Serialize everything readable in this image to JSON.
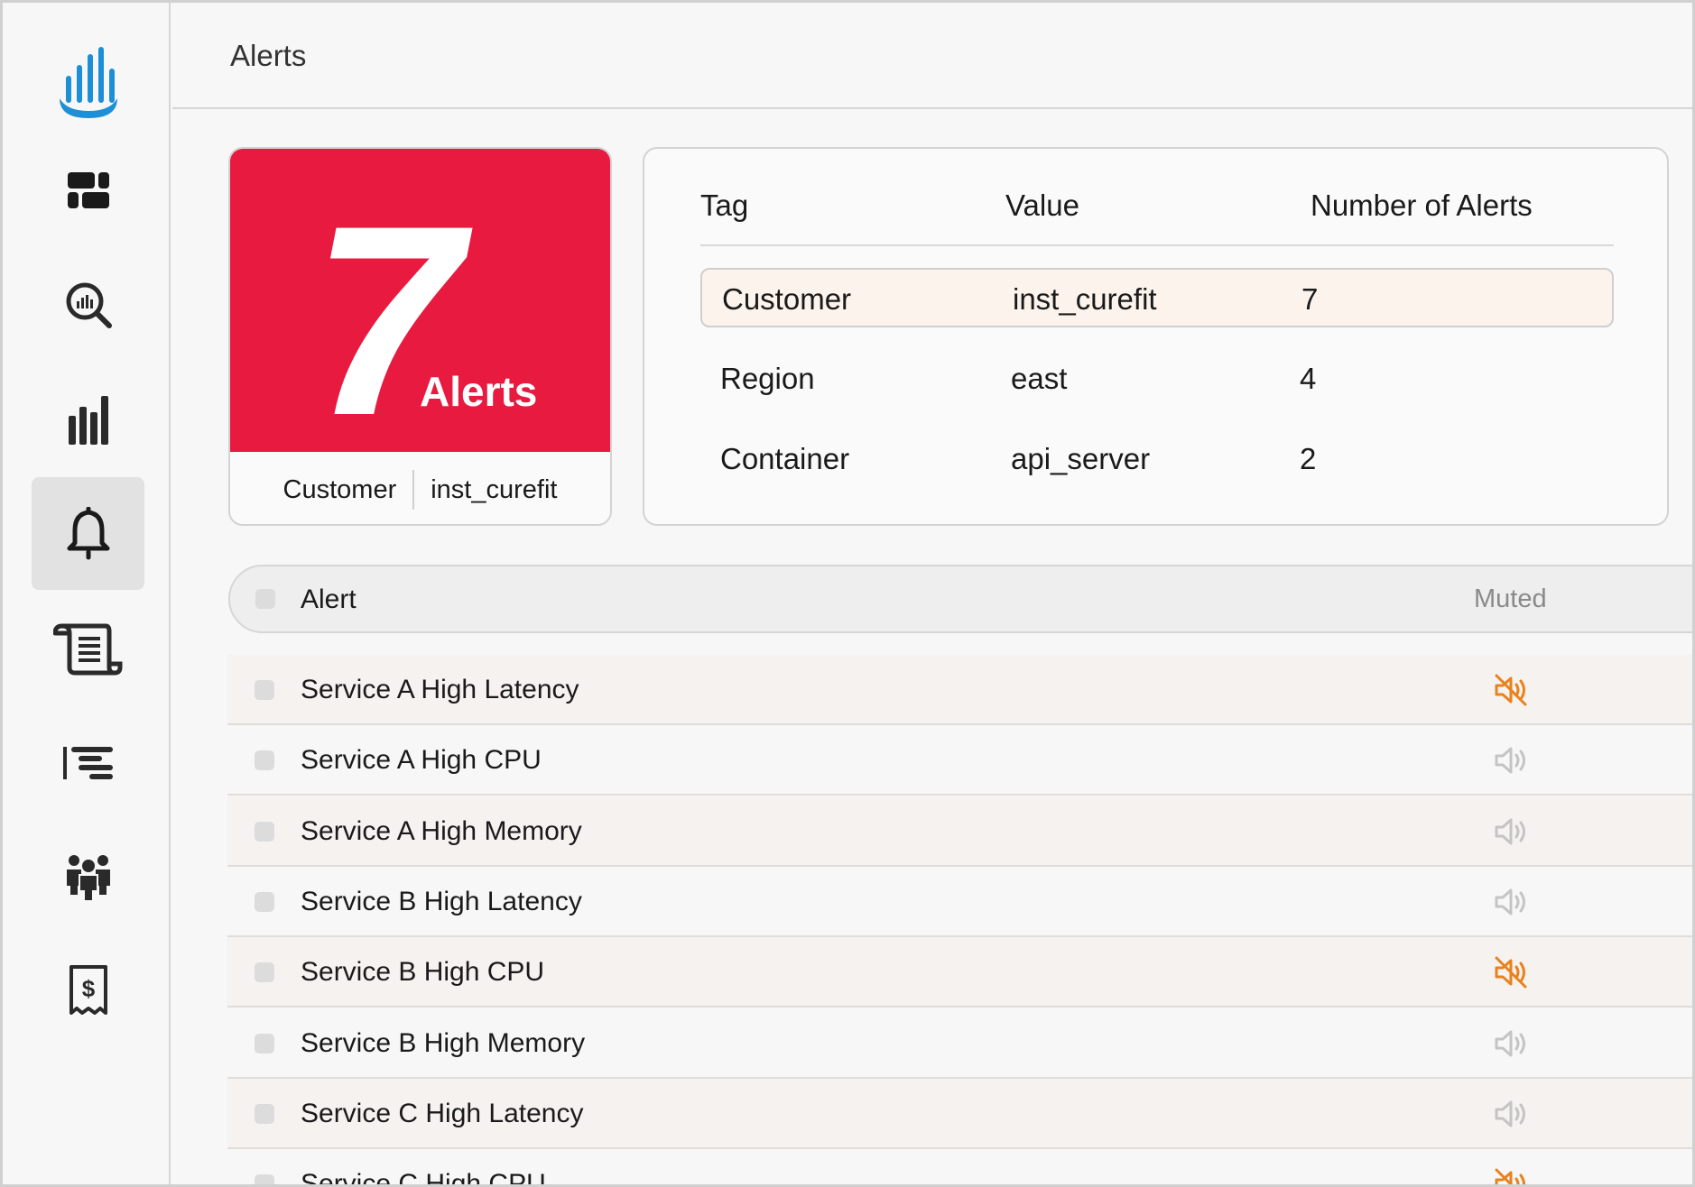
{
  "header": {
    "title": "Alerts"
  },
  "summary": {
    "count": "7",
    "count_label": "Alerts",
    "filter_tag": "Customer",
    "filter_value": "inst_curefit",
    "accent_color": "#e81a40"
  },
  "tag_table": {
    "columns": {
      "tag": "Tag",
      "value": "Value",
      "count": "Number of Alerts"
    },
    "rows": [
      {
        "tag": "Customer",
        "value": "inst_curefit",
        "count": "7",
        "selected": true
      },
      {
        "tag": "Region",
        "value": "east",
        "count": "4",
        "selected": false
      },
      {
        "tag": "Container",
        "value": "api_server",
        "count": "2",
        "selected": false
      }
    ]
  },
  "alert_list": {
    "header": {
      "alert": "Alert",
      "muted": "Muted"
    },
    "rows": [
      {
        "name": "Service A High Latency",
        "muted": true
      },
      {
        "name": "Service A High CPU",
        "muted": false
      },
      {
        "name": "Service A High Memory",
        "muted": false
      },
      {
        "name": "Service B High Latency",
        "muted": false
      },
      {
        "name": "Service B High CPU",
        "muted": true
      },
      {
        "name": "Service B High Memory",
        "muted": false
      },
      {
        "name": "Service C High Latency",
        "muted": false
      },
      {
        "name": "Service C High CPU",
        "muted": true
      }
    ],
    "muted_color": "#e8821e",
    "unmuted_color": "#c4c4c4"
  },
  "sidebar": {
    "items": [
      {
        "icon": "logo-icon"
      },
      {
        "icon": "dashboard-icon"
      },
      {
        "icon": "search-analytics-icon"
      },
      {
        "icon": "bar-chart-icon"
      },
      {
        "icon": "bell-icon",
        "active": true
      },
      {
        "icon": "scroll-log-icon"
      },
      {
        "icon": "list-align-icon"
      },
      {
        "icon": "team-icon"
      },
      {
        "icon": "billing-receipt-icon"
      }
    ]
  }
}
